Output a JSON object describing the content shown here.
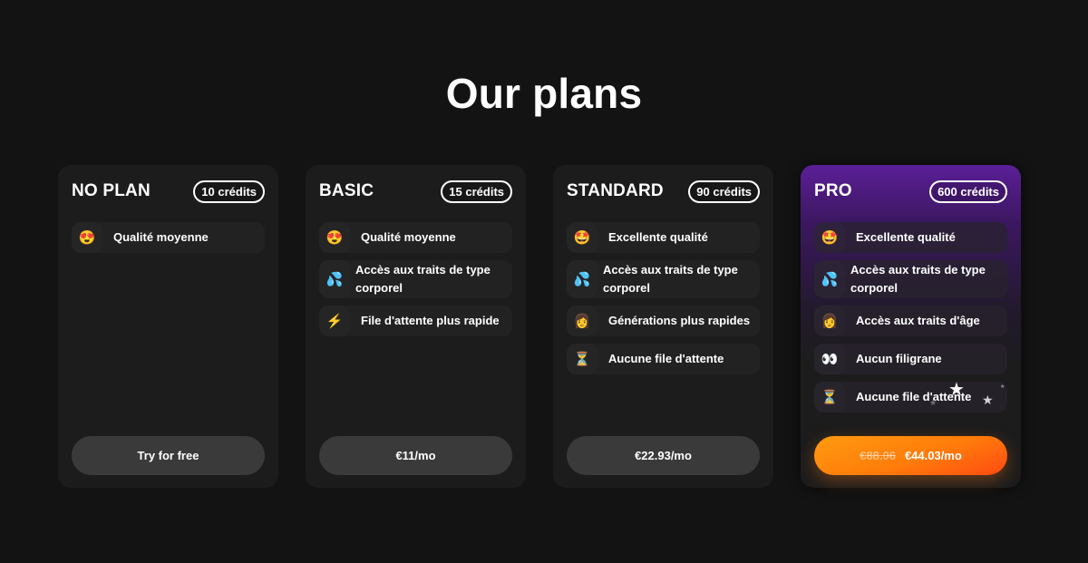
{
  "page": {
    "title": "Our plans"
  },
  "colors": {
    "background": "#131313",
    "card": "#1c1c1c",
    "button": "#3a3a3a",
    "pro_accent_purple": "#5b1f97",
    "pro_button_orange": "#ff7c0a"
  },
  "plans": [
    {
      "name": "NO PLAN",
      "credits": "10 crédits",
      "features": [
        {
          "icon": "heart-eyes-emoji",
          "glyph": "😍",
          "label": "Qualité moyenne"
        }
      ],
      "cta": {
        "label": "Try for free"
      }
    },
    {
      "name": "BASIC",
      "credits": "15 crédits",
      "features": [
        {
          "icon": "heart-eyes-emoji",
          "glyph": "😍",
          "label": "Qualité moyenne"
        },
        {
          "icon": "sweat-droplets-emoji",
          "glyph": "💦",
          "label": "Accès aux traits de type corporel"
        },
        {
          "icon": "lightning-emoji",
          "glyph": "⚡",
          "label": "File d'attente plus rapide"
        }
      ],
      "cta": {
        "label": "€11/mo"
      }
    },
    {
      "name": "STANDARD",
      "credits": "90 crédits",
      "features": [
        {
          "icon": "star-struck-emoji",
          "glyph": "🤩",
          "label": "Excellente qualité"
        },
        {
          "icon": "sweat-droplets-emoji",
          "glyph": "💦",
          "label": "Accès aux traits de type corporel"
        },
        {
          "icon": "woman-emoji",
          "glyph": "👩",
          "label": "Générations plus rapides"
        },
        {
          "icon": "hourglass-emoji",
          "glyph": "⏳",
          "label": "Aucune file d'attente"
        }
      ],
      "cta": {
        "label": "€22.93/mo"
      }
    },
    {
      "name": "PRO",
      "credits": "600 crédits",
      "features": [
        {
          "icon": "star-struck-emoji",
          "glyph": "🤩",
          "label": "Excellente qualité"
        },
        {
          "icon": "sweat-droplets-emoji",
          "glyph": "💦",
          "label": "Accès aux traits de type corporel"
        },
        {
          "icon": "woman-emoji",
          "glyph": "👩",
          "label": "Accès aux traits d'âge"
        },
        {
          "icon": "eyes-emoji",
          "glyph": "👀",
          "label": "Aucun filigrane"
        },
        {
          "icon": "hourglass-emoji",
          "glyph": "⏳",
          "label": "Aucune file d'attente"
        }
      ],
      "cta": {
        "old_price": "€88.06",
        "label": "€44.03/mo"
      }
    }
  ]
}
